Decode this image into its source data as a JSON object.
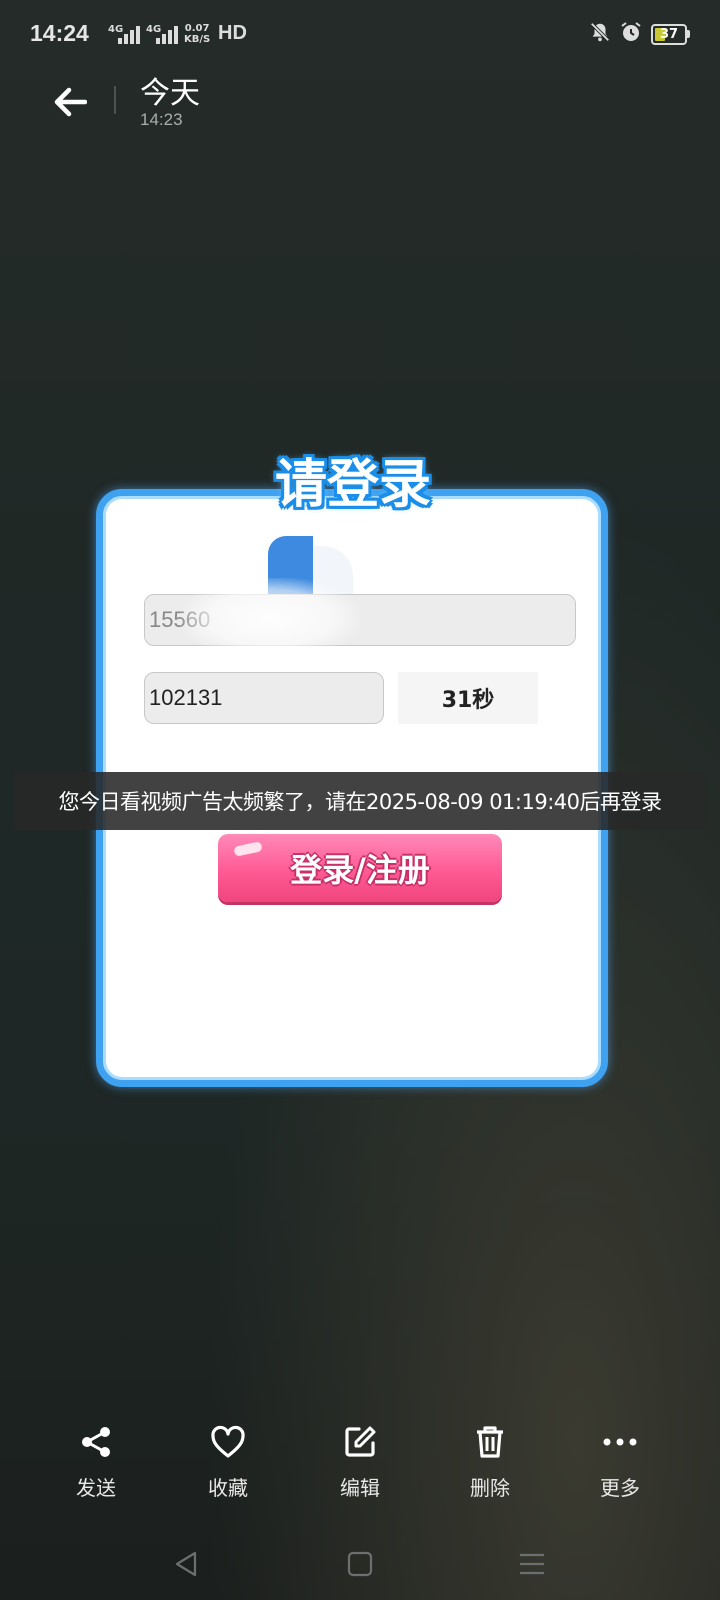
{
  "status_bar": {
    "time": "14:24",
    "net1": "4G",
    "net2": "4G",
    "speed_value": "0.07",
    "speed_unit": "KB/S",
    "hd": "HD",
    "battery": "37"
  },
  "header": {
    "title": "今天",
    "subtitle": "14:23"
  },
  "dialog": {
    "title": "请登录",
    "phone_value": "15560",
    "code_value": "102131",
    "countdown": "31秒",
    "login_button": "登录/注册"
  },
  "toast": {
    "message": "您今日看视频广告太频繁了，请在2025-08-09 01:19:40后再登录"
  },
  "actions": [
    {
      "label": "发送",
      "icon": "share-icon"
    },
    {
      "label": "收藏",
      "icon": "heart-icon"
    },
    {
      "label": "编辑",
      "icon": "edit-icon"
    },
    {
      "label": "删除",
      "icon": "trash-icon"
    },
    {
      "label": "更多",
      "icon": "more-icon"
    }
  ],
  "nav": [
    "back-triangle-icon",
    "home-square-icon",
    "menu-lines-icon"
  ]
}
